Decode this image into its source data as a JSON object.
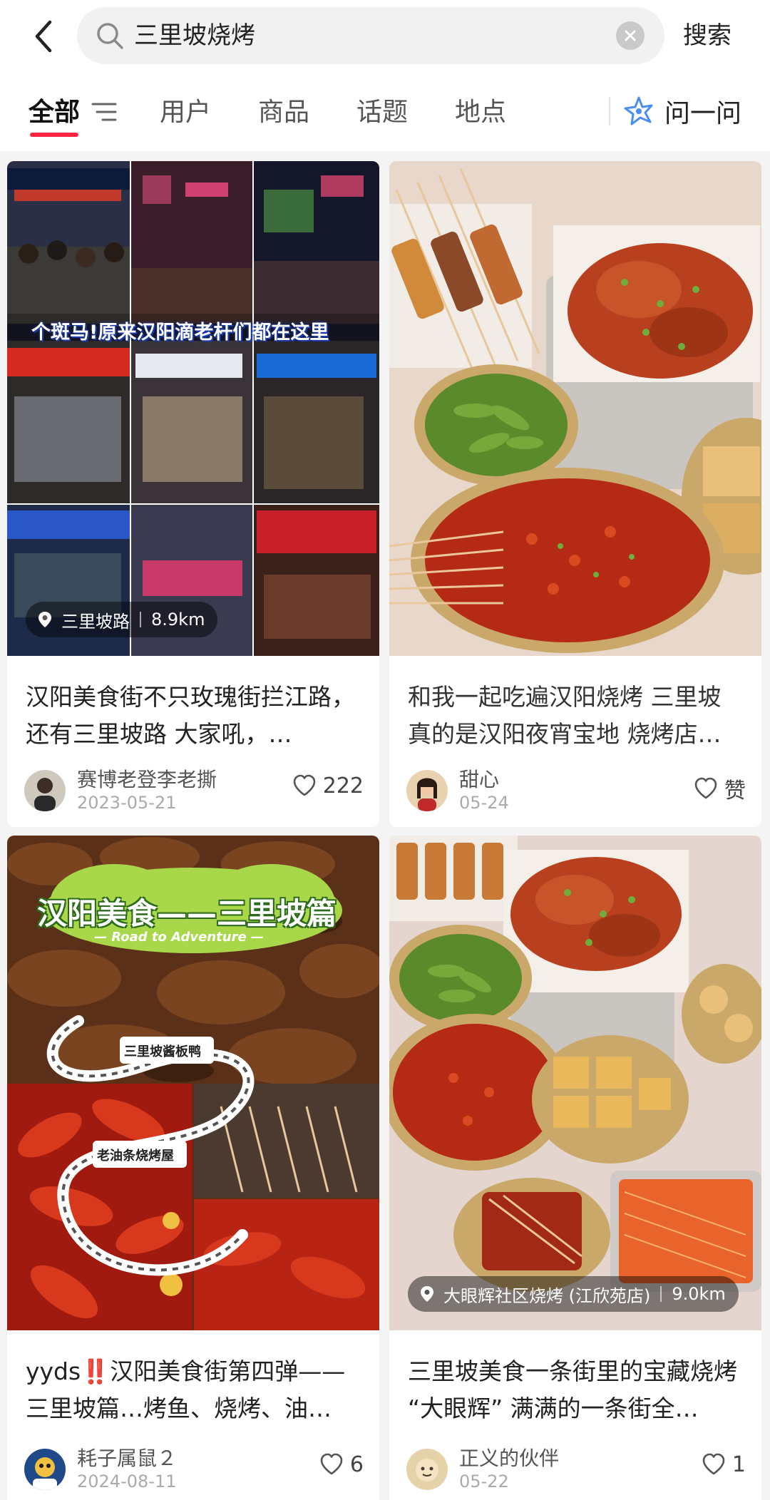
{
  "search": {
    "query": "三里坡烧烤",
    "button_label": "搜索"
  },
  "tabs": {
    "items": [
      "全部",
      "用户",
      "商品",
      "话题",
      "地点"
    ],
    "ask_label": "问一问"
  },
  "colors": {
    "accent": "#ff2442",
    "ask_icon": "#4a8df6"
  },
  "cards": [
    {
      "title": "汉阳美食街不只玫瑰街拦江路，还有三里坡路 大家吼，…",
      "author": "赛博老登李老撕",
      "date": "2023-05-21",
      "likes": "222",
      "image_caption": "个斑马!原来汉阳滴老杆们都在这里",
      "location": {
        "name": "三里坡路",
        "distance": "8.9km"
      }
    },
    {
      "title": "和我一起吃遍汉阳烧烤 三里坡真的是汉阳夜宵宝地 烧烤店…",
      "author": "甜心",
      "date": "05-24",
      "likes": "赞"
    },
    {
      "title": "yyds‼️汉阳美食街第四弹——三里坡篇…烤鱼、烧烤、油…",
      "author": "耗子属鼠２",
      "date": "2024-08-11",
      "likes": "6",
      "image_title": "汉阳美食——三里坡篇",
      "image_subtitle": "— Road to Adventure —",
      "image_tags": [
        "三里坡酱板鸭",
        "老油条烧烤屋"
      ]
    },
    {
      "title": "三里坡美食一条街里的宝藏烧烤 “大眼辉” 满满的一条街全…",
      "author": "正义的伙伴",
      "date": "05-22",
      "likes": "1",
      "location": {
        "name": "大眼辉社区烧烤 (江欣苑店)",
        "distance": "9.0km"
      }
    }
  ]
}
